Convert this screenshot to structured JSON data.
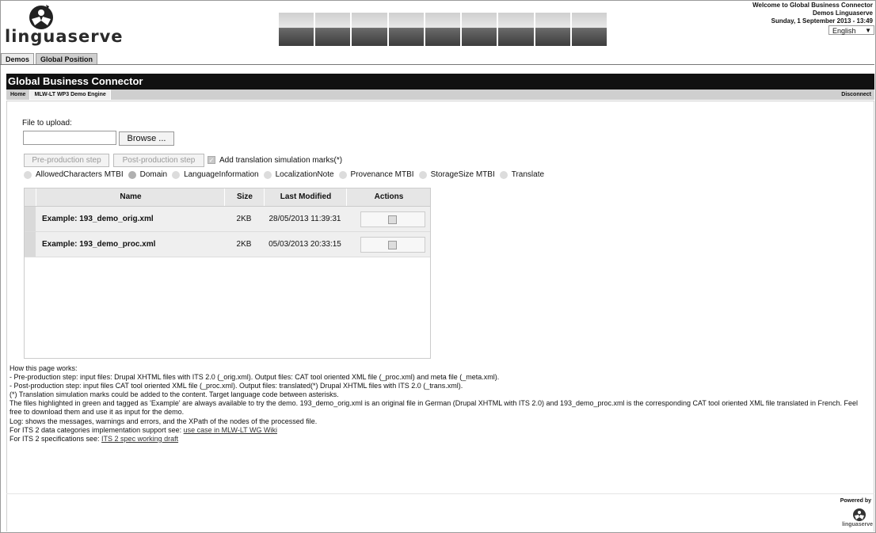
{
  "header": {
    "logo_text": "linguaserve",
    "welcome": "Welcome to Global Business Connector",
    "user": "Demos Linguaserve",
    "datetime": "Sunday, 1 September 2013 - 13:49",
    "language": "English"
  },
  "top_tabs": [
    "Demos",
    "Global Position"
  ],
  "app": {
    "title": "Global Business Connector",
    "nav": [
      "Home",
      "MLW-LT WP3 Demo Engine"
    ],
    "disconnect": "Disconnect"
  },
  "upload": {
    "label": "File to upload:",
    "browse": "Browse ...",
    "value": ""
  },
  "actions": {
    "pre": "Pre-production step",
    "post": "Post-production step",
    "sim_label": "Add translation simulation marks(*)"
  },
  "categories": [
    "AllowedCharacters MTBI",
    "Domain",
    "LanguageInformation",
    "LocalizationNote",
    "Provenance MTBI",
    "StorageSize MTBI",
    "Translate"
  ],
  "table": {
    "headers": [
      "Name",
      "Size",
      "Last Modified",
      "Actions"
    ],
    "rows": [
      {
        "name": "Example: 193_demo_orig.xml",
        "size": "2KB",
        "modified": "28/05/2013 11:39:31"
      },
      {
        "name": "Example: 193_demo_proc.xml",
        "size": "2KB",
        "modified": "05/03/2013 20:33:15"
      }
    ]
  },
  "help": {
    "lines": [
      "How this page works:",
      "- Pre-production step: input files: Drupal XHTML files with ITS 2.0 (_orig.xml). Output files: CAT tool oriented XML file (_proc.xml) and meta file (_meta.xml).",
      "- Post-production step: input files CAT tool oriented XML file (_proc.xml). Output files: translated(*) Drupal XHTML files with ITS 2.0 (_trans.xml).",
      "(*) Translation simulation marks could be added to the content. Target language code between asterisks.",
      "The files highlighted in green and tagged as 'Example' are always available to try the demo. 193_demo_orig.xml is an original file in German (Drupal XHTML with ITS 2.0) and 193_demo_proc.xml is the corresponding CAT tool oriented XML file translated in French. Feel free to download them and use it as input for the demo.",
      "Log: shows the messages, warnings and errors, and the XPath of the nodes of the processed file."
    ],
    "its_support_prefix": "For ITS 2 data categories implementation support see: ",
    "its_support_link": "use case in MLW-LT WG Wiki",
    "its_spec_prefix": "For ITS 2 specifications see: ",
    "its_spec_link": "ITS 2 spec working draft"
  },
  "footer": {
    "powered": "Powered by",
    "brand": "linguaserve"
  }
}
